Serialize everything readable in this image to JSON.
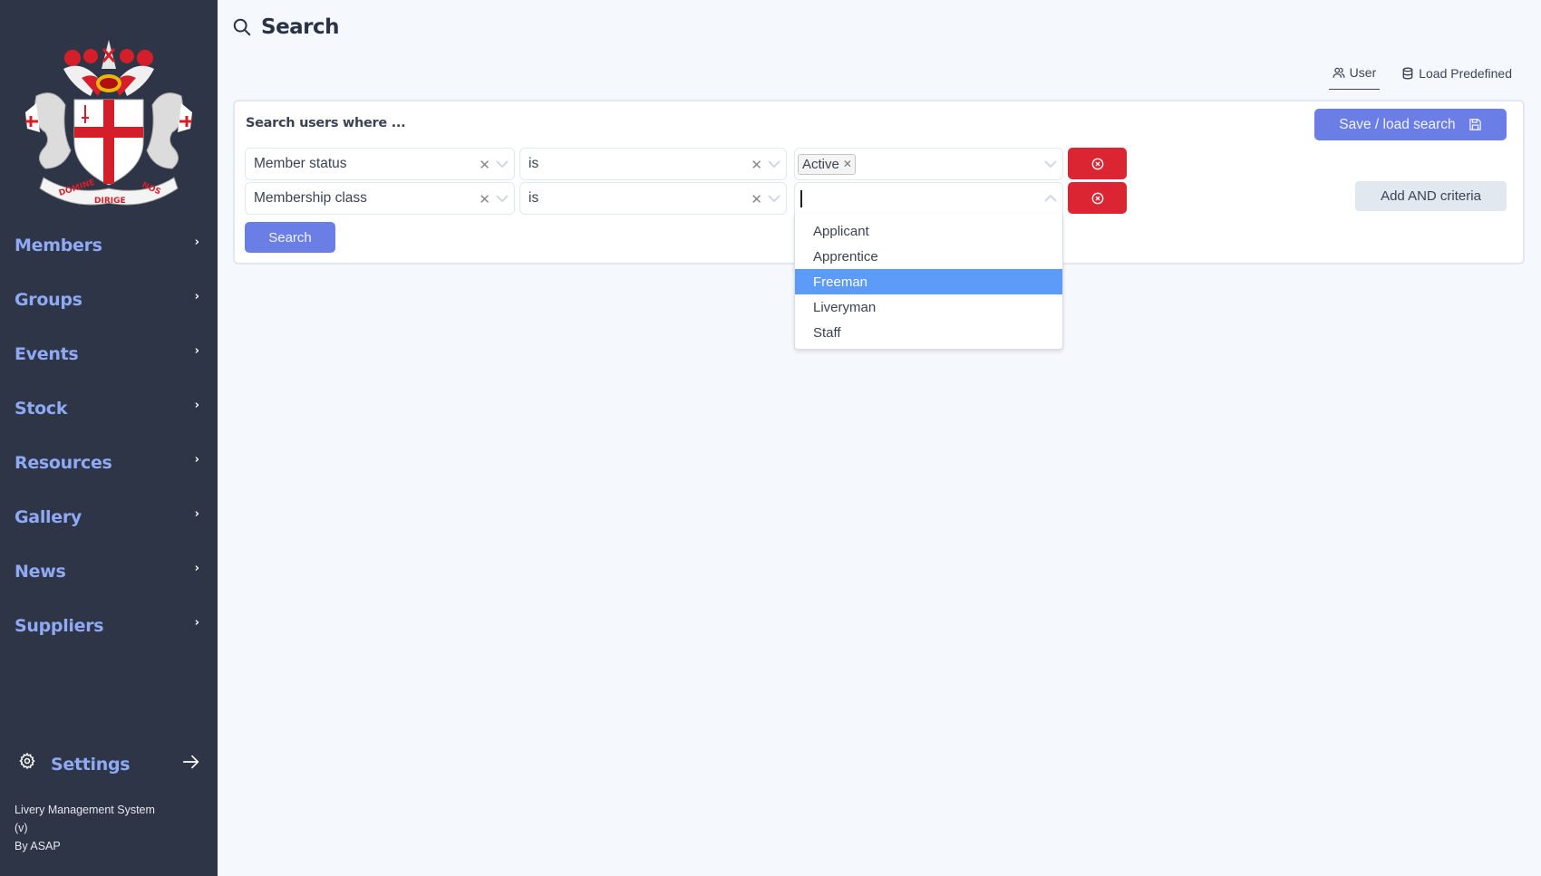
{
  "app": {
    "name": "Livery Management System",
    "version": "(v)",
    "by": "By ASAP"
  },
  "sidebar": {
    "logo": "city-of-london-crest",
    "crest_motto": [
      "DOMINE",
      "DIRIGE",
      "NOS"
    ],
    "items": [
      {
        "label": "Members"
      },
      {
        "label": "Groups"
      },
      {
        "label": "Events"
      },
      {
        "label": "Stock"
      },
      {
        "label": "Resources"
      },
      {
        "label": "Gallery"
      },
      {
        "label": "News"
      },
      {
        "label": "Suppliers"
      }
    ],
    "settings_label": "Settings",
    "footer": {
      "line1": "Livery Management System",
      "line2": "(v)",
      "line3": "By ASAP"
    }
  },
  "header": {
    "title": "Search",
    "icon": "search-icon"
  },
  "tabs": [
    {
      "label": "User",
      "icon": "users-icon",
      "active": true
    },
    {
      "label": "Load Predefined",
      "icon": "database-icon",
      "active": false
    }
  ],
  "search_card": {
    "heading": "Search users where ...",
    "save_button": "Save / load search",
    "add_and_button": "Add AND criteria",
    "search_button": "Search",
    "criteria": [
      {
        "field": "Member status",
        "operator": "is",
        "values": [
          "Active"
        ],
        "open": false
      },
      {
        "field": "Membership class",
        "operator": "is",
        "values": [],
        "open": true
      }
    ],
    "dropdown": {
      "options": [
        "Applicant",
        "Apprentice",
        "Freeman",
        "Liveryman",
        "Staff"
      ],
      "highlighted": "Freeman"
    }
  },
  "colors": {
    "sidebar_bg": "#2d3546",
    "sidebar_link": "#8fa9f5",
    "primary": "#6a7ee5",
    "danger": "#dc2533",
    "highlight": "#5c9bf7",
    "page_bg": "#f5f8fc"
  }
}
